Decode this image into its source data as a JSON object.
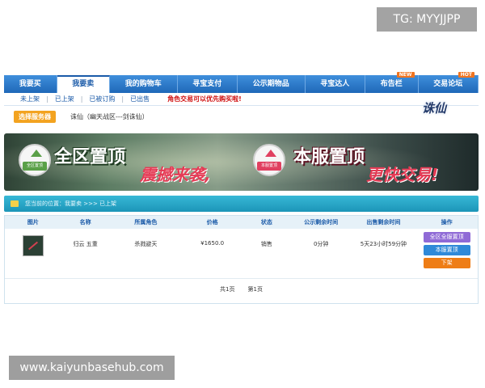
{
  "watermarks": {
    "tg": "TG: MYYJJPP",
    "url": "www.kaiyunbasehub.com"
  },
  "nav": {
    "tabs": [
      {
        "label": "我要买",
        "active": false,
        "badge": ""
      },
      {
        "label": "我要卖",
        "active": true,
        "badge": ""
      },
      {
        "label": "我的购物车",
        "active": false,
        "badge": ""
      },
      {
        "label": "寻宝支付",
        "active": false,
        "badge": ""
      },
      {
        "label": "公示期物品",
        "active": false,
        "badge": ""
      },
      {
        "label": "寻宝达人",
        "active": false,
        "badge": ""
      },
      {
        "label": "布告栏",
        "active": false,
        "badge": "NEW"
      },
      {
        "label": "交易论坛",
        "active": false,
        "badge": "HOT"
      }
    ]
  },
  "subnav": {
    "items": [
      "未上架",
      "已上架",
      "已被订购",
      "已出售"
    ],
    "notice": "角色交易可以优先购买啦!"
  },
  "server": {
    "select_label": "选择服务器",
    "current": "诛仙（幽天战区---剑诛仙）",
    "logo": "诛仙"
  },
  "banner": {
    "text1": "全区置顶",
    "text2": "震撼来袭,",
    "text3": "本服置顶",
    "text4": "更快交易!",
    "tag1": "全区置顶",
    "tag2": "本服置顶"
  },
  "breadcrumb": {
    "text": "您当前的位置：我要卖  >>> 已上架"
  },
  "table": {
    "headers": [
      "图片",
      "名称",
      "所属角色",
      "价格",
      "状态",
      "公示剩余时间",
      "出售剩余时间",
      "操作"
    ],
    "rows": [
      {
        "name": "归云 五重",
        "role": "杀戮避天",
        "price": "¥1650.0",
        "status": "销售",
        "public_time": "0分钟",
        "sale_time": "5天23小时59分钟"
      }
    ],
    "actions": [
      "全区全服置顶",
      "本服置顶",
      "下架"
    ]
  },
  "pager": {
    "total": "共1页",
    "current": "第1页"
  },
  "colors": {
    "nav_blue": "#1f68b8",
    "teal": "#1c95b8",
    "orange": "#ee7d16",
    "purple": "#8f6ad6"
  }
}
